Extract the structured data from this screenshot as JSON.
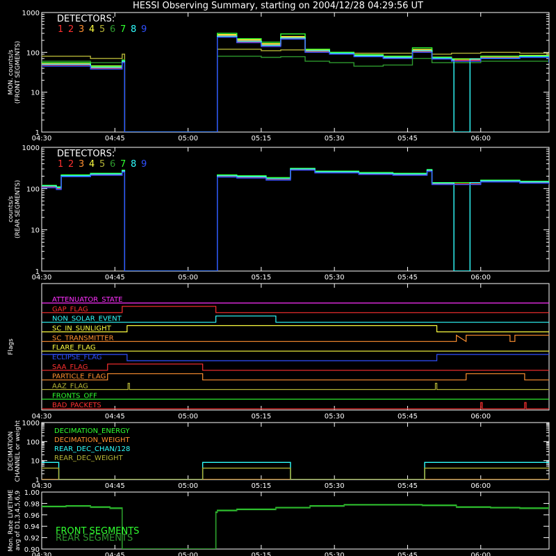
{
  "title": "HESSI Observing Summary, starting on 2004/12/28 04:29:56 UT",
  "time_ticks": [
    "04:30",
    "04:45",
    "05:00",
    "05:15",
    "05:30",
    "05:45",
    "06:00"
  ],
  "chart_data": [
    {
      "type": "line",
      "panel": "front",
      "ylabel": [
        "MON. counts/s",
        "(FRONT SEGMENTS)"
      ],
      "ylim": [
        1,
        1000
      ],
      "log_y": true,
      "y_ticks": [
        "1",
        "10",
        "100",
        "1000"
      ],
      "legend_title": "DETECTORS:",
      "x_unit": "minutes after 04:30 UT",
      "xlim": [
        0,
        104
      ],
      "series": [
        {
          "name": "1",
          "color": "#ff3030",
          "x": [
            0,
            10,
            16.5,
            17,
            35.7,
            36,
            40,
            45,
            49,
            54,
            59,
            64,
            70,
            76,
            80,
            84,
            90,
            98,
            104
          ],
          "y": [
            50,
            42,
            60,
            1,
            1,
            260,
            190,
            150,
            230,
            110,
            95,
            82,
            75,
            110,
            72,
            65,
            75,
            80,
            60
          ]
        },
        {
          "name": "2",
          "color": "#ff3030",
          "x": [
            0,
            10,
            16.5,
            17,
            35.7,
            36,
            40,
            45,
            49,
            54,
            59,
            64,
            70,
            76,
            80,
            84,
            90,
            98,
            104
          ],
          "y": [
            48,
            40,
            58,
            1,
            1,
            250,
            180,
            145,
            225,
            105,
            92,
            80,
            72,
            105,
            70,
            63,
            72,
            78,
            58
          ]
        },
        {
          "name": "3",
          "color": "#ff9030",
          "x": [
            0,
            10,
            16.5,
            17,
            35.7,
            36,
            40,
            45,
            49,
            54,
            59,
            64,
            70,
            76,
            80,
            84,
            90,
            98,
            104
          ],
          "y": [
            52,
            44,
            62,
            1,
            1,
            270,
            200,
            160,
            240,
            115,
            98,
            85,
            78,
            115,
            74,
            67,
            78,
            82,
            62
          ]
        },
        {
          "name": "4",
          "color": "#ffff40",
          "x": [
            0,
            10,
            16.5,
            17,
            35.7,
            36,
            40,
            45,
            49,
            54,
            59,
            64,
            70,
            76,
            80,
            84,
            90,
            98,
            104
          ],
          "y": [
            55,
            46,
            64,
            1,
            1,
            280,
            210,
            165,
            250,
            118,
            100,
            88,
            80,
            118,
            76,
            69,
            80,
            84,
            64
          ]
        },
        {
          "name": "5",
          "color": "#b4b436",
          "x": [
            0,
            10,
            16.5,
            17,
            35.7,
            36,
            40,
            45,
            49,
            54,
            59,
            64,
            70,
            76,
            80,
            84,
            90,
            98,
            104
          ],
          "y": [
            80,
            70,
            90,
            1,
            1,
            120,
            120,
            110,
            115,
            100,
            100,
            95,
            95,
            100,
            90,
            95,
            100,
            95,
            85
          ]
        },
        {
          "name": "6",
          "color": "#2e9a2e",
          "x": [
            0,
            10,
            16.5,
            17,
            35.7,
            36,
            40,
            45,
            49,
            54,
            59,
            64,
            70,
            76,
            80,
            84,
            90,
            98,
            104
          ],
          "y": [
            60,
            55,
            65,
            1,
            1,
            80,
            80,
            75,
            78,
            60,
            55,
            45,
            48,
            70,
            55,
            55,
            60,
            60,
            55
          ]
        },
        {
          "name": "7",
          "color": "#30ff30",
          "x": [
            0,
            10,
            16.5,
            17,
            35.7,
            36,
            40,
            45,
            49,
            54,
            59,
            64,
            70,
            76,
            80,
            84,
            90,
            98,
            104
          ],
          "y": [
            55,
            45,
            63,
            1,
            1,
            300,
            220,
            180,
            290,
            120,
            100,
            88,
            80,
            130,
            75,
            68,
            80,
            82,
            62
          ]
        },
        {
          "name": "8",
          "color": "#30ffff",
          "x": [
            0,
            10,
            16.5,
            17,
            35.7,
            36,
            40,
            45,
            49,
            54,
            59,
            64,
            70,
            76,
            80,
            84,
            84.5,
            87.2,
            87.8,
            90,
            98,
            104
          ],
          "y": [
            50,
            42,
            60,
            1,
            1,
            255,
            190,
            150,
            230,
            110,
            95,
            82,
            75,
            110,
            72,
            65,
            1,
            1,
            68,
            72,
            78,
            58
          ]
        },
        {
          "name": "9",
          "color": "#3050ff",
          "x": [
            0,
            10,
            16.5,
            17,
            35.7,
            36,
            40,
            45,
            49,
            54,
            59,
            64,
            70,
            76,
            80,
            84,
            90,
            98,
            104
          ],
          "y": [
            45,
            38,
            55,
            1,
            1,
            240,
            175,
            140,
            215,
            100,
            90,
            78,
            70,
            100,
            68,
            60,
            70,
            75,
            55
          ]
        }
      ]
    },
    {
      "type": "line",
      "panel": "rear",
      "ylabel": [
        "counts/s",
        "(REAR SEGMENTS)"
      ],
      "ylim": [
        1,
        1000
      ],
      "log_y": true,
      "y_ticks": [
        "1",
        "10",
        "100",
        "1000"
      ],
      "legend_title": "DETECTORS:",
      "x_unit": "minutes after 04:30 UT",
      "xlim": [
        0,
        104
      ],
      "series": [
        {
          "name": "1",
          "color": "#ff3030",
          "x": [
            0,
            3,
            4,
            10,
            16.5,
            17,
            35.7,
            36,
            40,
            46,
            51,
            56,
            65,
            72,
            79,
            80,
            90,
            98,
            104
          ],
          "y": [
            110,
            100,
            200,
            220,
            260,
            1,
            1,
            200,
            190,
            170,
            290,
            250,
            230,
            220,
            270,
            130,
            150,
            140,
            130
          ]
        },
        {
          "name": "7",
          "color": "#30ff30",
          "x": [
            0,
            3,
            4,
            10,
            16.5,
            17,
            35.7,
            36,
            40,
            46,
            51,
            56,
            65,
            72,
            79,
            80,
            90,
            98,
            104
          ],
          "y": [
            120,
            110,
            215,
            235,
            280,
            1,
            1,
            215,
            205,
            185,
            310,
            265,
            245,
            235,
            290,
            140,
            160,
            150,
            140
          ]
        },
        {
          "name": "8",
          "color": "#30ffff",
          "x": [
            0,
            3,
            4,
            10,
            16.5,
            17,
            35.7,
            36,
            40,
            46,
            51,
            56,
            65,
            72,
            79,
            80,
            84.5,
            87.2,
            87.8,
            90,
            98,
            104
          ],
          "y": [
            115,
            105,
            205,
            225,
            270,
            1,
            1,
            205,
            195,
            175,
            300,
            255,
            235,
            225,
            280,
            135,
            1,
            1,
            140,
            155,
            145,
            135
          ]
        },
        {
          "name": "9",
          "color": "#3050ff",
          "x": [
            0,
            3,
            4,
            10,
            16.5,
            17,
            35.7,
            36,
            40,
            46,
            51,
            56,
            65,
            72,
            79,
            80,
            90,
            98,
            104
          ],
          "y": [
            105,
            95,
            195,
            210,
            250,
            1,
            1,
            190,
            180,
            160,
            280,
            240,
            220,
            210,
            260,
            125,
            145,
            135,
            125
          ]
        }
      ]
    },
    {
      "type": "line",
      "panel": "flags",
      "ylabel": [
        "Flags"
      ],
      "x_unit": "minutes after 04:30 UT",
      "xlim": [
        0,
        104
      ],
      "flags": [
        {
          "label": "ATTENUATOR_STATE",
          "color": "#ff30ff",
          "x": [
            0,
            104
          ],
          "v": [
            0,
            0
          ]
        },
        {
          "label": "GAP_FLAG",
          "color": "#ff3030",
          "x": [
            0,
            16.5,
            16.5,
            35.7,
            35.7,
            104
          ],
          "v": [
            0,
            0,
            1,
            1,
            0,
            0
          ]
        },
        {
          "label": "NON_SOLAR_EVENT",
          "color": "#30ffff",
          "x": [
            0,
            35.7,
            35.7,
            48,
            48,
            104
          ],
          "v": [
            0,
            0,
            1,
            1,
            0,
            0
          ]
        },
        {
          "label": "SC_IN_SUNLIGHT",
          "color": "#ffff40",
          "x": [
            0,
            17.5,
            17.5,
            81,
            81,
            104
          ],
          "v": [
            0,
            0,
            1,
            1,
            0,
            0
          ]
        },
        {
          "label": "SC_TRANSMITTER",
          "color": "#ff9030",
          "x": [
            0,
            85,
            85,
            87,
            87,
            96,
            96,
            97,
            97,
            104
          ],
          "v": [
            0,
            0,
            1,
            0,
            1,
            1,
            0,
            0,
            1,
            1
          ]
        },
        {
          "label": "FLARE_FLAG",
          "color": "#ffff40",
          "x": [
            0,
            104
          ],
          "v": [
            0,
            0
          ]
        },
        {
          "label": "ECLIPSE_FLAG",
          "color": "#3050ff",
          "x": [
            0,
            17.5,
            17.5,
            81,
            81,
            104
          ],
          "v": [
            1,
            1,
            0,
            0,
            1,
            1
          ]
        },
        {
          "label": "SAA_FLAG",
          "color": "#ff3030",
          "x": [
            0,
            13.5,
            13.5,
            33,
            33,
            104
          ],
          "v": [
            0,
            0,
            1,
            1,
            0,
            0
          ]
        },
        {
          "label": "PARTICLE_FLAG",
          "color": "#ff9030",
          "x": [
            0,
            13.5,
            13.5,
            33,
            33,
            87,
            87,
            99,
            99,
            104
          ],
          "v": [
            0,
            0,
            1,
            1,
            0,
            0,
            1,
            1,
            0,
            0
          ]
        },
        {
          "label": "AAZ_FLAG",
          "color": "#b4b436",
          "x": [
            0,
            17.7,
            17.7,
            18,
            18,
            80.7,
            80.7,
            81,
            81,
            104
          ],
          "v": [
            0,
            0,
            1,
            1,
            0,
            0,
            1,
            1,
            0,
            0
          ]
        },
        {
          "label": "FRONTS_OFF",
          "color": "#30ff30",
          "x": [
            0,
            104
          ],
          "v": [
            0,
            0
          ]
        },
        {
          "label": "BAD_PACKETS",
          "color": "#ff3030",
          "x": [
            0,
            90,
            90,
            90.3,
            90.3,
            99,
            99,
            99.3,
            99.3,
            104
          ],
          "v": [
            0,
            0,
            1,
            1,
            0,
            0,
            1,
            1,
            0,
            0
          ]
        }
      ]
    },
    {
      "type": "line",
      "panel": "decimation",
      "ylabel": [
        "DECIMATION",
        "CHANNEL or weight"
      ],
      "ylim": [
        1,
        1000
      ],
      "log_y": true,
      "y_ticks": [
        "1",
        "10",
        "100",
        "1000"
      ],
      "x_unit": "minutes after 04:30 UT",
      "xlim": [
        0,
        104
      ],
      "series": [
        {
          "name": "DECIMATION_ENERGY",
          "color": "#30ff30",
          "x": [
            0,
            104
          ],
          "y": [
            1,
            1
          ]
        },
        {
          "name": "DECIMATION_WEIGHT",
          "color": "#ff9030",
          "x": [
            0,
            104
          ],
          "y": [
            1,
            1
          ]
        },
        {
          "name": "REAR_DEC_CHAN/128",
          "color": "#30ffff",
          "x": [
            0,
            3.5,
            3.5,
            33,
            33,
            51,
            51,
            78.5,
            78.5,
            104
          ],
          "y": [
            8,
            8,
            1,
            1,
            8,
            8,
            1,
            1,
            8,
            8
          ]
        },
        {
          "name": "REAR_DEC_WEIGHT",
          "color": "#b4b436",
          "x": [
            0,
            3.5,
            3.5,
            33,
            33,
            51,
            51,
            78.5,
            78.5,
            104
          ],
          "y": [
            4,
            4,
            1,
            1,
            4,
            4,
            1,
            1,
            4,
            4
          ]
        }
      ]
    },
    {
      "type": "line",
      "panel": "livetime",
      "ylabel": [
        "Mon. Rate LIVETIME",
        "avg of D1,3,4,5,6,9"
      ],
      "ylim": [
        0.9,
        1.0
      ],
      "y_ticks": [
        "0.90",
        "0.92",
        "0.94",
        "0.96",
        "0.98",
        "1.00"
      ],
      "x_unit": "minutes after 04:30 UT",
      "xlim": [
        0,
        104
      ],
      "series": [
        {
          "name": "FRONT SEGMENTS",
          "color": "#30ff30",
          "x": [
            0,
            5,
            10,
            14,
            16.5,
            16.5,
            35.7,
            35.7,
            36,
            40,
            48,
            55,
            62,
            70,
            78,
            85,
            92,
            98,
            104
          ],
          "y": [
            0.975,
            0.976,
            0.974,
            0.972,
            0.972,
            0.9,
            0.9,
            0.965,
            0.968,
            0.97,
            0.973,
            0.976,
            0.978,
            0.978,
            0.977,
            0.974,
            0.973,
            0.972,
            0.978
          ]
        },
        {
          "name": "REAR SEGMENTS",
          "color": "#2e9a2e",
          "x": [
            0,
            5,
            10,
            14,
            16.5,
            16.5,
            35.7,
            35.7,
            36,
            40,
            48,
            55,
            62,
            70,
            78,
            85,
            92,
            98,
            104
          ],
          "y": [
            0.974,
            0.975,
            0.973,
            0.971,
            0.971,
            0.9,
            0.9,
            0.964,
            0.967,
            0.969,
            0.972,
            0.975,
            0.977,
            0.977,
            0.976,
            0.973,
            0.972,
            0.971,
            0.977
          ]
        }
      ]
    }
  ]
}
